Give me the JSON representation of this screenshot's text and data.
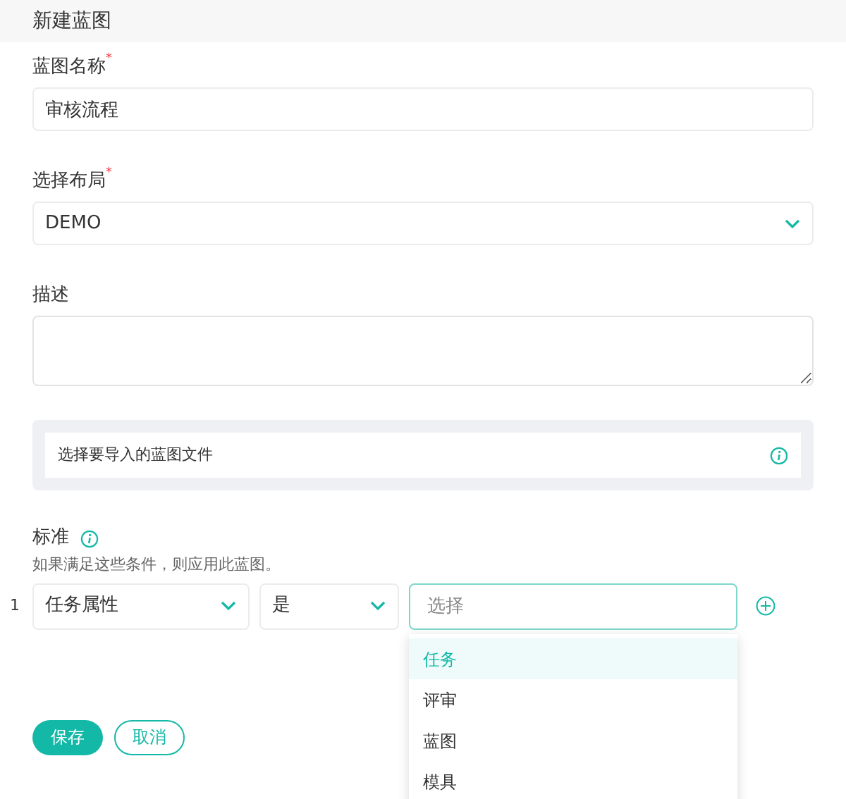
{
  "header": {
    "title": "新建蓝图"
  },
  "fields": [
    {
      "kind": "text",
      "label": "蓝图名称",
      "required_mark": "*",
      "value": "审核流程"
    },
    {
      "kind": "select",
      "label": "选择布局",
      "required_mark": "*",
      "value": "DEMO"
    },
    {
      "kind": "textarea",
      "label": "描述"
    }
  ],
  "import": {
    "label": "选择要导入的蓝图文件"
  },
  "criteria": {
    "title": "标准",
    "hint": "如果满足这些条件，则应用此蓝图。",
    "rows": [
      {
        "number": "1",
        "field": "任务属性",
        "operator": "是",
        "value_placeholder": "选择"
      }
    ]
  },
  "dropdown": {
    "options": [
      {
        "label": "任务",
        "selected": true
      },
      {
        "label": "评审",
        "selected": false
      },
      {
        "label": "蓝图",
        "selected": false
      },
      {
        "label": "模具",
        "selected": false
      }
    ]
  },
  "buttons": [
    {
      "kind": "primary",
      "label": "保存"
    },
    {
      "kind": "secondary",
      "label": "取消"
    }
  ]
}
